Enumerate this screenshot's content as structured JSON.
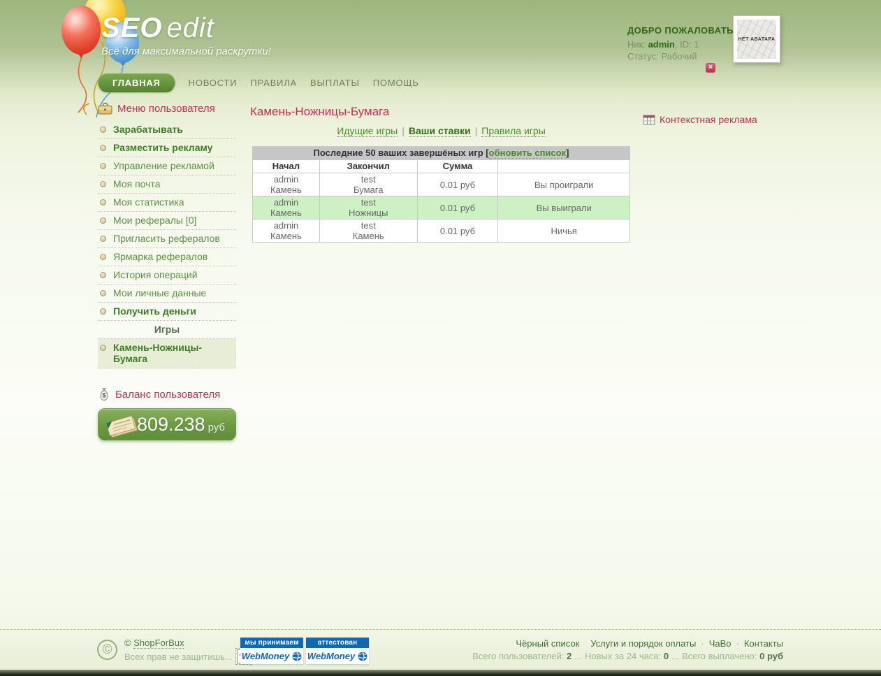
{
  "colors": {
    "accent_red": "#c13154",
    "accent_green": "#4a8a2e",
    "win_row_bg": "#cdf1c3",
    "webmoney_blue": "#1268b0",
    "balance_green": "#6b9a42"
  },
  "logo": {
    "title_bold": "SEO",
    "title_light": "edit",
    "tagline": "Всё для максимальной раскрутки!"
  },
  "nav": {
    "items": [
      {
        "label": "ГЛАВНАЯ",
        "active": true
      },
      {
        "label": "НОВОСТИ",
        "active": false
      },
      {
        "label": "ПРАВИЛА",
        "active": false
      },
      {
        "label": "ВЫПЛАТЫ",
        "active": false
      },
      {
        "label": "ПОМОЩЬ",
        "active": false
      }
    ]
  },
  "welcome": {
    "title": "ДОБРО ПОЖАЛОВАТЬ",
    "nick_label": "Ник:",
    "nick": "admin",
    "id_text": ", ID: 1",
    "status_label": "Статус:",
    "status": "Рабочий",
    "avatar_text": "НЕТ АВАТАРА",
    "close_label": "×"
  },
  "sidebar": {
    "menu_title": "Меню пользователя",
    "items": [
      {
        "label": "Зарабатывать"
      },
      {
        "label": "Разместить рекламу"
      },
      {
        "label": "Управление рекламой"
      },
      {
        "label": "Моя почта"
      },
      {
        "label": "Моя статистика"
      },
      {
        "label": "Мои рефералы [0]"
      },
      {
        "label": "Пригласить рефералов"
      },
      {
        "label": "Ярмарка рефералов"
      },
      {
        "label": "История операций"
      },
      {
        "label": "Мои личные данные"
      },
      {
        "label": "Получить деньги"
      }
    ],
    "games_header": "Игры",
    "game_item": "Камень-Ножницы-Бумага",
    "balance_title": "Баланс пользователя",
    "balance_amount": "809.238",
    "balance_currency": "руб"
  },
  "main": {
    "title": "Камень-Ножницы-Бумага",
    "tab_separator": "|",
    "tabs": [
      {
        "label": "Идущие игры",
        "active": false
      },
      {
        "label": "Ваши ставки",
        "active": true
      },
      {
        "label": "Правила игры",
        "active": false
      }
    ],
    "table": {
      "caption": "Последние 50 ваших завершёных игр",
      "refresh_open": "[",
      "refresh_link": "обновить список",
      "refresh_close": "]",
      "columns": [
        "Начал",
        "Закончил",
        "Сумма"
      ],
      "rows": [
        {
          "starter": "admin",
          "starter_move": "Камень",
          "finisher": "test",
          "finisher_move": "Бумага",
          "amount": "0.01 руб",
          "result": "Вы проиграли"
        },
        {
          "starter": "admin",
          "starter_move": "Камень",
          "finisher": "test",
          "finisher_move": "Ножницы",
          "amount": "0.01 руб",
          "result": "Вы выиграли"
        },
        {
          "starter": "admin",
          "starter_move": "Камень",
          "finisher": "test",
          "finisher_move": "Камень",
          "amount": "0.01 руб",
          "result": "Ничья"
        }
      ]
    }
  },
  "aside": {
    "context_ad_label": "Контекстная реклама"
  },
  "footer": {
    "copyright_symbol": "©",
    "copyright_prefix": "©",
    "copyright_link": "ShopForBux",
    "copyright_note": "Всех прав не защитишь...",
    "badges": [
      {
        "top": "мы принимаем",
        "brand": "WebMoney"
      },
      {
        "top": "аттестован",
        "brand": "WebMoney"
      }
    ],
    "links": [
      {
        "label": "Чёрный список"
      },
      {
        "label": "Услуги и порядок оплаты"
      },
      {
        "label": "ЧаВо"
      },
      {
        "label": "Контакты"
      }
    ],
    "links_separator": "·",
    "stats_separator": "...",
    "stats": [
      {
        "label": "Всего пользователей:",
        "value": "2"
      },
      {
        "label": "Новых за 24 часа:",
        "value": "0"
      },
      {
        "label": "Всего выплачено:",
        "value": "0 руб"
      }
    ]
  }
}
